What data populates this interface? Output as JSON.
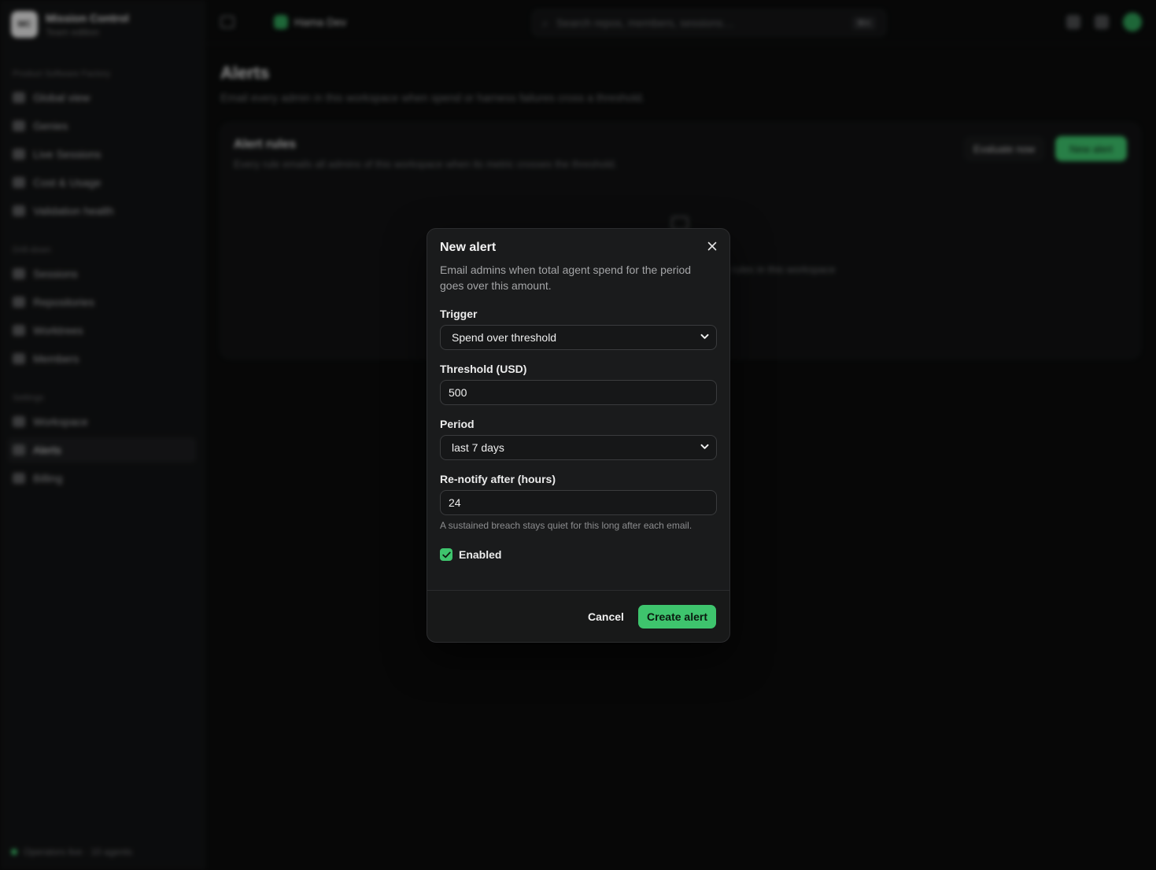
{
  "app": {
    "brand_name": "Mission Control",
    "brand_sub": "Team edition",
    "logo_text": "MC"
  },
  "sidebar": {
    "sections": [
      {
        "title": "Product Software Factory",
        "items": [
          {
            "label": "Global view",
            "icon": "grid-icon"
          },
          {
            "label": "Genies",
            "icon": "sparkle-icon"
          },
          {
            "label": "Live Sessions",
            "icon": "pulse-icon"
          },
          {
            "label": "Cost & Usage",
            "icon": "receipt-icon"
          },
          {
            "label": "Validation health",
            "icon": "check-circle-icon"
          }
        ]
      },
      {
        "title": "Drill-down",
        "items": [
          {
            "label": "Sessions",
            "icon": "terminal-icon"
          },
          {
            "label": "Repositories",
            "icon": "folder-icon"
          },
          {
            "label": "Worktrees",
            "icon": "branch-icon"
          },
          {
            "label": "Members",
            "icon": "users-icon"
          }
        ]
      },
      {
        "title": "Settings",
        "items": [
          {
            "label": "Workspace",
            "icon": "building-icon"
          },
          {
            "label": "Alerts",
            "icon": "bell-icon",
            "active": true
          },
          {
            "label": "Billing",
            "icon": "card-icon"
          }
        ]
      }
    ],
    "footer": "Operators live · 10 agents"
  },
  "topbar": {
    "workspace": "Hama Dev",
    "search_placeholder": "Search repos, members, sessions…",
    "search_shortcut": "⌘K"
  },
  "page": {
    "title": "Alerts",
    "subtitle": "Email every admin in this workspace when spend or harness failures cross a threshold.",
    "card_title": "Alert rules",
    "card_subtitle": "Every rule emails all admins of this workspace when its metric crosses the threshold.",
    "evaluate_label": "Evaluate now",
    "new_alert_label": "New alert",
    "empty_text": "No alert rules in this workspace"
  },
  "modal": {
    "title": "New alert",
    "description": "Email admins when total agent spend for the period goes over this amount.",
    "trigger_label": "Trigger",
    "trigger_value": "Spend over threshold",
    "threshold_label": "Threshold (USD)",
    "threshold_value": "500",
    "period_label": "Period",
    "period_value": "last 7 days",
    "renotify_label": "Re-notify after (hours)",
    "renotify_value": "24",
    "renotify_help": "A sustained breach stays quiet for this long after each email.",
    "enabled_label": "Enabled",
    "enabled": true,
    "cancel_label": "Cancel",
    "create_label": "Create alert"
  },
  "colors": {
    "accent": "#3ec46d",
    "modal_bg": "#1a1b1c",
    "page_bg": "#0b0c0c"
  }
}
